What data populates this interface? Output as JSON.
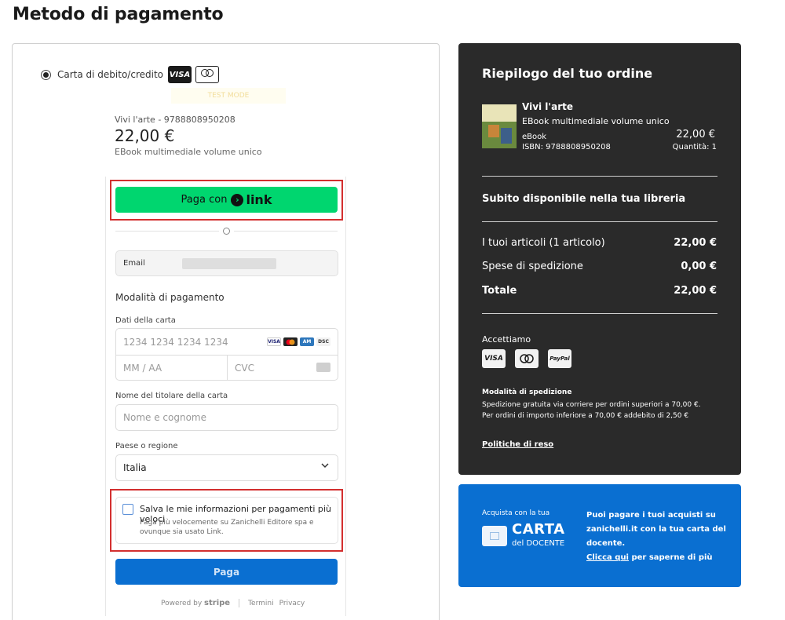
{
  "page": {
    "title": "Metodo di pagamento"
  },
  "payment_method": {
    "option_label": "Carta di debito/credito",
    "logos": [
      "visa",
      "mastercard"
    ],
    "test_badge": "TEST MODE"
  },
  "product": {
    "name": "Vivi l'arte - 9788808950208",
    "price": "22,00 €",
    "description": "EBook multimediale volume unico"
  },
  "stripe": {
    "link_button": {
      "prefix": "Paga con",
      "brand": "link"
    },
    "divider_label": "O",
    "email": {
      "label": "Email",
      "value": ""
    },
    "section_title": "Modalità di pagamento",
    "card_details_label": "Dati della carta",
    "card_number_placeholder": "1234 1234 1234 1234",
    "expiry_placeholder": "MM / AA",
    "cvc_placeholder": "CVC",
    "card_brands": [
      "VISA",
      "MC",
      "AMEX",
      "DISCOVER"
    ],
    "holder_label": "Nome del titolare della carta",
    "holder_placeholder": "Nome e cognome",
    "country_label": "Paese o regione",
    "country_value": "Italia",
    "save_title": "Salva le mie informazioni per pagamenti più veloci",
    "save_subtitle": "Paga più velocemente su Zanichelli Editore spa e ovunque sia usato Link.",
    "pay_button": "Paga",
    "footer": {
      "powered_by": "Powered by",
      "brand": "stripe",
      "terms": "Termini",
      "privacy": "Privacy"
    }
  },
  "summary": {
    "title": "Riepilogo del tuo ordine",
    "item": {
      "title": "Vivi l'arte",
      "description": "EBook multimediale volume unico",
      "type": "eBook",
      "isbn": "ISBN: 9788808950208",
      "price": "22,00 €",
      "quantity": "Quantità: 1"
    },
    "availability": "Subito disponibile nella tua libreria",
    "rows": [
      {
        "label": "I tuoi articoli (1 articolo)",
        "value": "22,00 €"
      },
      {
        "label": "Spese di spedizione",
        "value": "0,00 €"
      },
      {
        "label": "Totale",
        "value": "22,00 €"
      }
    ],
    "accept_label": "Accettiamo",
    "accepted": [
      "VISA",
      "mastercard",
      "PayPal"
    ],
    "shipping_title": "Modalità di spedizione",
    "shipping_text_1": "Spedizione gratuita via corriere per ordini superiori a 70,00 €.",
    "shipping_text_2": "Per ordini di importo inferiore a 70,00 € addebito di 2,50 €",
    "returns_link": "Politiche di reso"
  },
  "docente": {
    "small": "Acquista con la tua",
    "big": "CARTA",
    "sub": "del DOCENTE",
    "text": "Puoi pagare i tuoi acquisti su zanichelli.it con la tua carta del docente.",
    "link": "Clicca qui",
    "link_suffix": " per saperne di più"
  },
  "colors": {
    "link_green": "#00d66f",
    "pay_blue": "#0a6fd1",
    "summary_bg": "#2a2a2a",
    "highlight_red": "#d32f2f"
  }
}
